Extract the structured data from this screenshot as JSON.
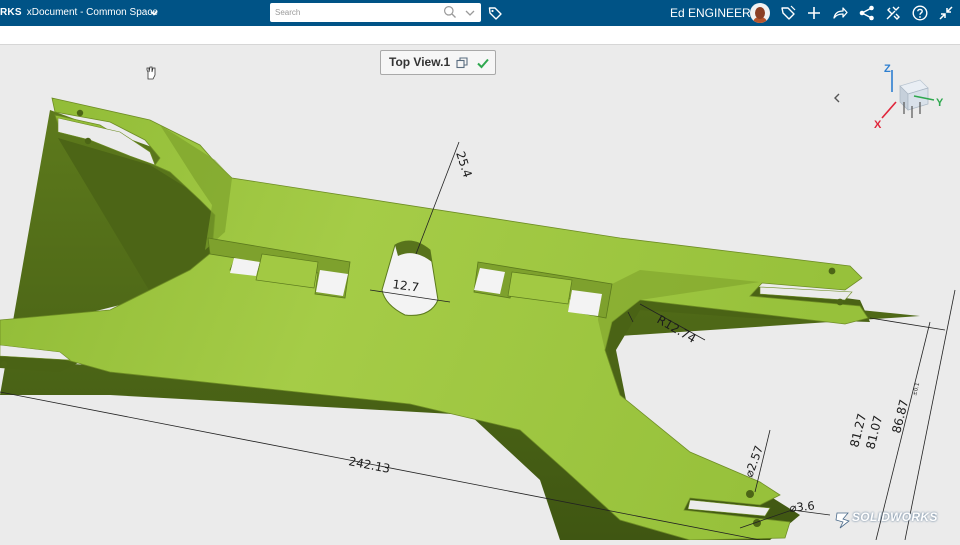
{
  "header": {
    "app_name": "RKS",
    "document_title": "xDocument - Common Space",
    "search_placeholder": "Search",
    "user_name": "Ed ENGINEER"
  },
  "icons": {
    "title_menu": "chevron-down-icon",
    "search": "search-icon",
    "search_menu": "chevron-down-icon",
    "tag": "tag-icon",
    "toolbar": [
      "tag-outline-icon",
      "plus-icon",
      "share-arrow-icon",
      "share-network-icon",
      "tools-icon",
      "help-icon",
      "collapse-icon"
    ],
    "view": [
      "copy-icon",
      "checkmark-icon"
    ],
    "viewport": [
      "cursor-icon",
      "chevron-left-icon",
      "triad-icon"
    ]
  },
  "view_label": {
    "title": "Top View.1"
  },
  "triad": {
    "z": "Z",
    "y": "Y",
    "x": "X"
  },
  "dimensions": {
    "d1": "25.4",
    "d2": "12.7",
    "d3": "R12.74",
    "d4": "242.13",
    "d5": "⌀2.57",
    "d6": "⌀3.6",
    "d7": "81.27",
    "d8": "81.07",
    "d9": "86.87",
    "d9_tol": "±0.1"
  },
  "brand": {
    "logo_prefix": "3S",
    "logo_text": "SOLIDWORKS"
  },
  "colors": {
    "topbar": "#005386",
    "part_green": "#9cc43c",
    "part_shadow": "#56701a",
    "viewport_background": "#ebebeb",
    "axis_x": "#e0263b",
    "axis_y": "#2fa84f",
    "axis_z": "#2d7fd0",
    "check": "#2fa84f"
  }
}
